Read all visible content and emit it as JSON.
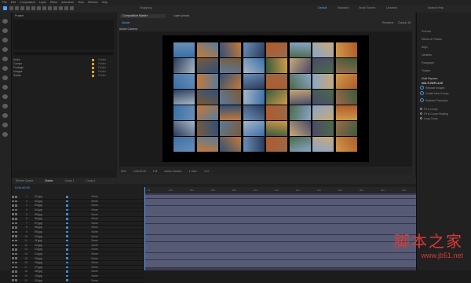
{
  "menubar": [
    "File",
    "Edit",
    "Composition",
    "Layer",
    "Effect",
    "Animation",
    "View",
    "Window",
    "Help"
  ],
  "toolbar": {
    "snapping": "Snapping",
    "workspaces": [
      "Default",
      "Standard",
      "Small Screen",
      "Libraries"
    ],
    "search": "Search Help"
  },
  "project": {
    "tab": "Project",
    "items": [
      {
        "name": "Audio",
        "type": "Folder"
      },
      {
        "name": "Comps",
        "type": "Folder"
      },
      {
        "name": "Footage",
        "type": "Folder"
      },
      {
        "name": "Images",
        "type": "Folder"
      },
      {
        "name": "Solids",
        "type": "Folder"
      }
    ]
  },
  "composition": {
    "tab": "Composition Master",
    "tab2": "Layer (none)",
    "sub": "Master",
    "active_camera": "Active Camera",
    "renderer": "Renderer",
    "classic": "Classic 3D"
  },
  "viewer_bar": [
    "50%",
    "0;00;00;00",
    "Full",
    "Active Camera",
    "1 View",
    "+0.0"
  ],
  "photo_colors": [
    "#3a6fa8",
    "#c47a3a",
    "#2f4f7a",
    "#6a8fb8",
    "#b05a2a",
    "#4a6a4a",
    "#8aa6c8",
    "#d09a4a",
    "#2a3a5a",
    "#7a5a3a",
    "#5a7a9a",
    "#a8b8c8",
    "#3a5a3a",
    "#c8a878",
    "#4a4a6a",
    "#9a6a4a"
  ],
  "right_panel": {
    "items": [
      "Preview",
      "Effects & Presets",
      "Align",
      "Libraries",
      "Paragraph",
      "Tracker"
    ],
    "script_head": "Multi Replace",
    "script_title": "MULTI-REPLACE",
    "buttons": [
      "Replace Images",
      "Create New Comps",
      "Replace Precomps"
    ],
    "options": [
      "Fit to Comp",
      "Fit to Comp Keeping",
      "Loop Comp"
    ]
  },
  "timeline": {
    "tabs": [
      "Render Queue",
      "Master",
      "Comp 1",
      "Comp 2"
    ],
    "timecode": "0;00;00;00",
    "ruler": [
      "0s",
      "02s",
      "04s",
      "06s",
      "08s",
      "10s",
      "12s",
      "14s",
      "16s",
      "18s",
      "20s",
      "22s",
      "24s"
    ],
    "layers": [
      {
        "num": "1",
        "name": "01.jpg"
      },
      {
        "num": "2",
        "name": "02.jpg"
      },
      {
        "num": "3",
        "name": "03.jpg"
      },
      {
        "num": "4",
        "name": "04.jpg"
      },
      {
        "num": "5",
        "name": "05.jpg"
      },
      {
        "num": "6",
        "name": "06.jpg"
      },
      {
        "num": "7",
        "name": "07.jpg"
      },
      {
        "num": "8",
        "name": "08.jpg"
      },
      {
        "num": "9",
        "name": "09.jpg"
      },
      {
        "num": "10",
        "name": "10.jpg"
      },
      {
        "num": "11",
        "name": "11.jpg"
      },
      {
        "num": "12",
        "name": "12.jpg"
      },
      {
        "num": "13",
        "name": "13.jpg"
      },
      {
        "num": "14",
        "name": "14.jpg"
      },
      {
        "num": "15",
        "name": "15.jpg"
      },
      {
        "num": "16",
        "name": "16.jpg"
      },
      {
        "num": "17",
        "name": "17.jpg"
      },
      {
        "num": "18",
        "name": "18.jpg"
      },
      {
        "num": "19",
        "name": "19.jpg"
      },
      {
        "num": "20",
        "name": "20.jpg"
      }
    ],
    "mode": "None"
  },
  "watermark": {
    "big": "脚本之家",
    "small": "www.jb51.net"
  }
}
